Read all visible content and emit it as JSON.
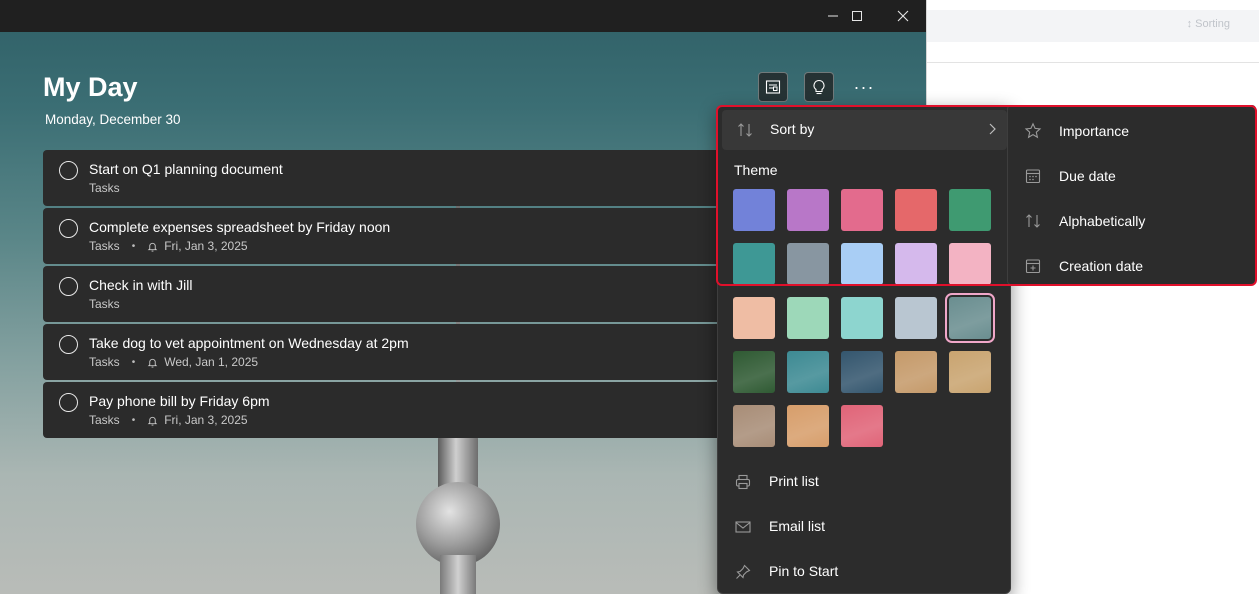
{
  "window": {
    "controls": {
      "minimize": "minimize",
      "maximize": "maximize",
      "close": "close"
    }
  },
  "header": {
    "title": "My Day",
    "date": "Monday, December 30",
    "buttons": [
      {
        "icon": "suggestions-view-icon"
      },
      {
        "icon": "lightbulb-icon"
      },
      {
        "icon": "more-options-icon",
        "label": "···"
      }
    ]
  },
  "tasks": [
    {
      "title": "Start on Q1 planning document",
      "list": "Tasks",
      "due": ""
    },
    {
      "title": "Complete expenses spreadsheet by Friday noon",
      "list": "Tasks",
      "due": "Fri, Jan 3, 2025"
    },
    {
      "title": "Check in with Jill",
      "list": "Tasks",
      "due": ""
    },
    {
      "title": "Take dog to vet appointment on Wednesday at 2pm",
      "list": "Tasks",
      "due": "Wed, Jan 1, 2025"
    },
    {
      "title": "Pay phone bill by Friday 6pm",
      "list": "Tasks",
      "due": "Fri, Jan 3, 2025"
    }
  ],
  "menu": {
    "sort_by": "Sort by",
    "theme_label": "Theme",
    "themes": [
      {
        "name": "blue",
        "color": "#7282d9"
      },
      {
        "name": "purple",
        "color": "#b877c8"
      },
      {
        "name": "pink",
        "color": "#e36b8d"
      },
      {
        "name": "red",
        "color": "#e5686a"
      },
      {
        "name": "green",
        "color": "#3f9a71"
      },
      {
        "name": "teal",
        "color": "#3e9895"
      },
      {
        "name": "gray",
        "color": "#8896a1"
      },
      {
        "name": "light-blue",
        "color": "#a9cef5"
      },
      {
        "name": "lavender",
        "color": "#d5b9ec"
      },
      {
        "name": "light-pink",
        "color": "#f3b3c3"
      },
      {
        "name": "peach",
        "color": "#efbda4"
      },
      {
        "name": "mint",
        "color": "#9dd8b9"
      },
      {
        "name": "aqua",
        "color": "#8dd5cf"
      },
      {
        "name": "silver",
        "color": "#b9c6d1"
      },
      {
        "name": "tower-photo",
        "color": "#6a8e90",
        "selected": true
      },
      {
        "name": "leaves-photo",
        "color": "#2f5a33"
      },
      {
        "name": "beach-photo",
        "color": "#3d8a93"
      },
      {
        "name": "mountains-photo",
        "color": "#34566e"
      },
      {
        "name": "palms-photo",
        "color": "#c59a6a"
      },
      {
        "name": "desert-photo",
        "color": "#c9a470"
      },
      {
        "name": "lighthouse-photo",
        "color": "#a88d77"
      },
      {
        "name": "poppy-photo",
        "color": "#d79e6b"
      },
      {
        "name": "pink-flower-photo",
        "color": "#e06478"
      }
    ],
    "items": [
      {
        "label": "Print list",
        "icon": "printer-icon"
      },
      {
        "label": "Email list",
        "icon": "mail-icon"
      },
      {
        "label": "Pin to Start",
        "icon": "pin-icon"
      }
    ]
  },
  "submenu": {
    "items": [
      {
        "label": "Importance",
        "icon": "star-icon"
      },
      {
        "label": "Due date",
        "icon": "calendar-icon"
      },
      {
        "label": "Alphabetically",
        "icon": "sort-arrows-icon"
      },
      {
        "label": "Creation date",
        "icon": "calendar-add-icon"
      }
    ]
  },
  "background_window": {
    "chip_text": "↕ Sorting"
  },
  "highlight_color": "#e0102b"
}
